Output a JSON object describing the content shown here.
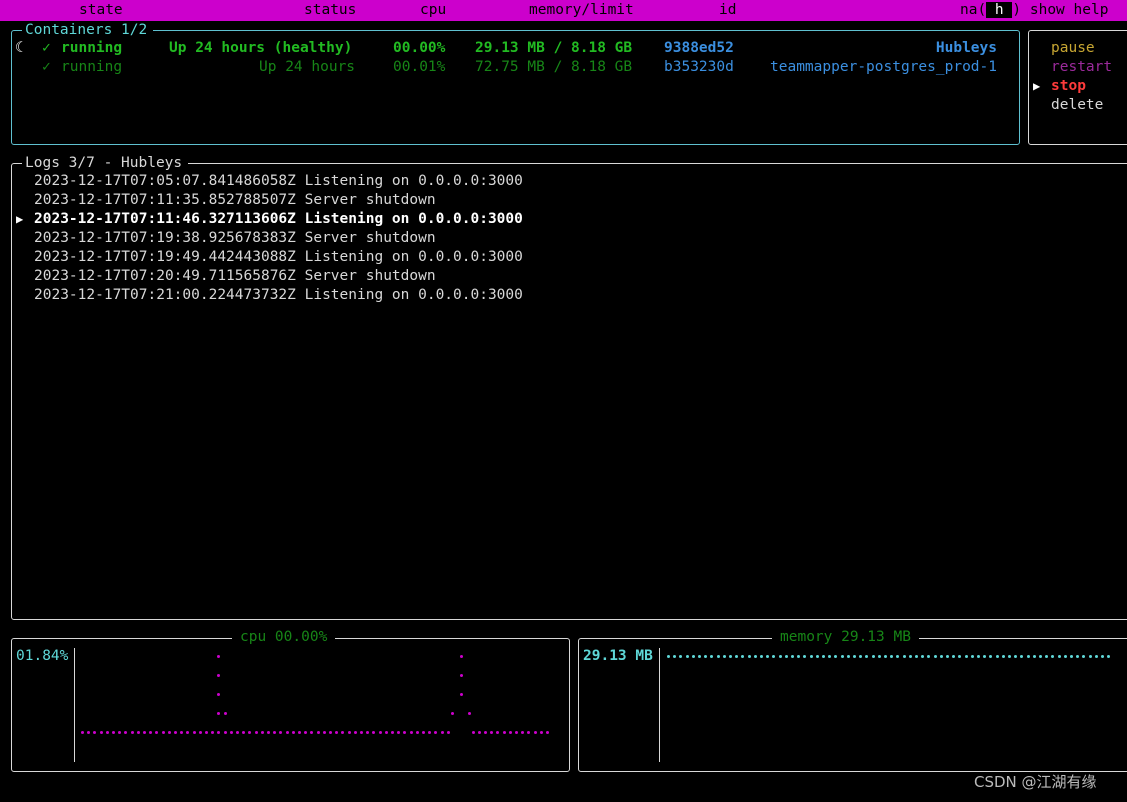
{
  "header": {
    "col_state": "state",
    "col_status": "status",
    "col_cpu": "cpu",
    "col_memory": "memory/limit",
    "col_id": "id",
    "help_prefix": "na(",
    "help_key": " h ",
    "help_suffix": ") show help"
  },
  "containers": {
    "title": "Containers 1/2",
    "spinner": "☾",
    "rows": [
      {
        "check": "✓",
        "state": "running",
        "status": "Up 24 hours (healthy)",
        "cpu": "00.00%",
        "memory": "29.13 MB / 8.18 GB",
        "id": "9388ed52",
        "name": "Hubleys",
        "selected": true
      },
      {
        "check": "✓",
        "state": "running",
        "status": "Up 24 hours",
        "cpu": "00.01%",
        "memory": "72.75 MB / 8.18 GB",
        "id": "b353230d",
        "name": "teammapper-postgres_prod-1",
        "selected": false
      }
    ]
  },
  "commands": {
    "pointer": "▶",
    "items": [
      {
        "label": "pause",
        "color": "#c7a632"
      },
      {
        "label": "restart",
        "color": "#9b2a9b"
      },
      {
        "label": "stop",
        "color": "#ff3b3b"
      },
      {
        "label": "delete",
        "color": "#d8d8d8"
      }
    ],
    "selected_index": 2
  },
  "logs": {
    "title": "Logs 3/7 - Hubleys",
    "pointer": "▶",
    "selected_index": 2,
    "lines": [
      "2023-12-17T07:05:07.841486058Z Listening on 0.0.0.0:3000",
      "2023-12-17T07:11:35.852788507Z Server shutdown",
      "2023-12-17T07:11:46.327113606Z Listening on 0.0.0.0:3000",
      "2023-12-17T07:19:38.925678383Z Server shutdown",
      "2023-12-17T07:19:49.442443088Z Listening on 0.0.0.0:3000",
      "2023-12-17T07:20:49.711565876Z Server shutdown",
      "2023-12-17T07:21:00.224473732Z Listening on 0.0.0.0:3000"
    ]
  },
  "cpu_chart": {
    "title": "cpu 00.00%",
    "max_label": "01.84%",
    "color": "#cc00cc"
  },
  "memory_chart": {
    "title": "memory 29.13 MB",
    "max_label": "29.13 MB",
    "color": "#5fd7d7"
  },
  "watermark": "CSDN @江湖有缘",
  "colors": {
    "accent": "#cc00cc",
    "border": "#d8d8d8",
    "running_green": "#22bb22",
    "id_blue": "#3b8fe0"
  }
}
